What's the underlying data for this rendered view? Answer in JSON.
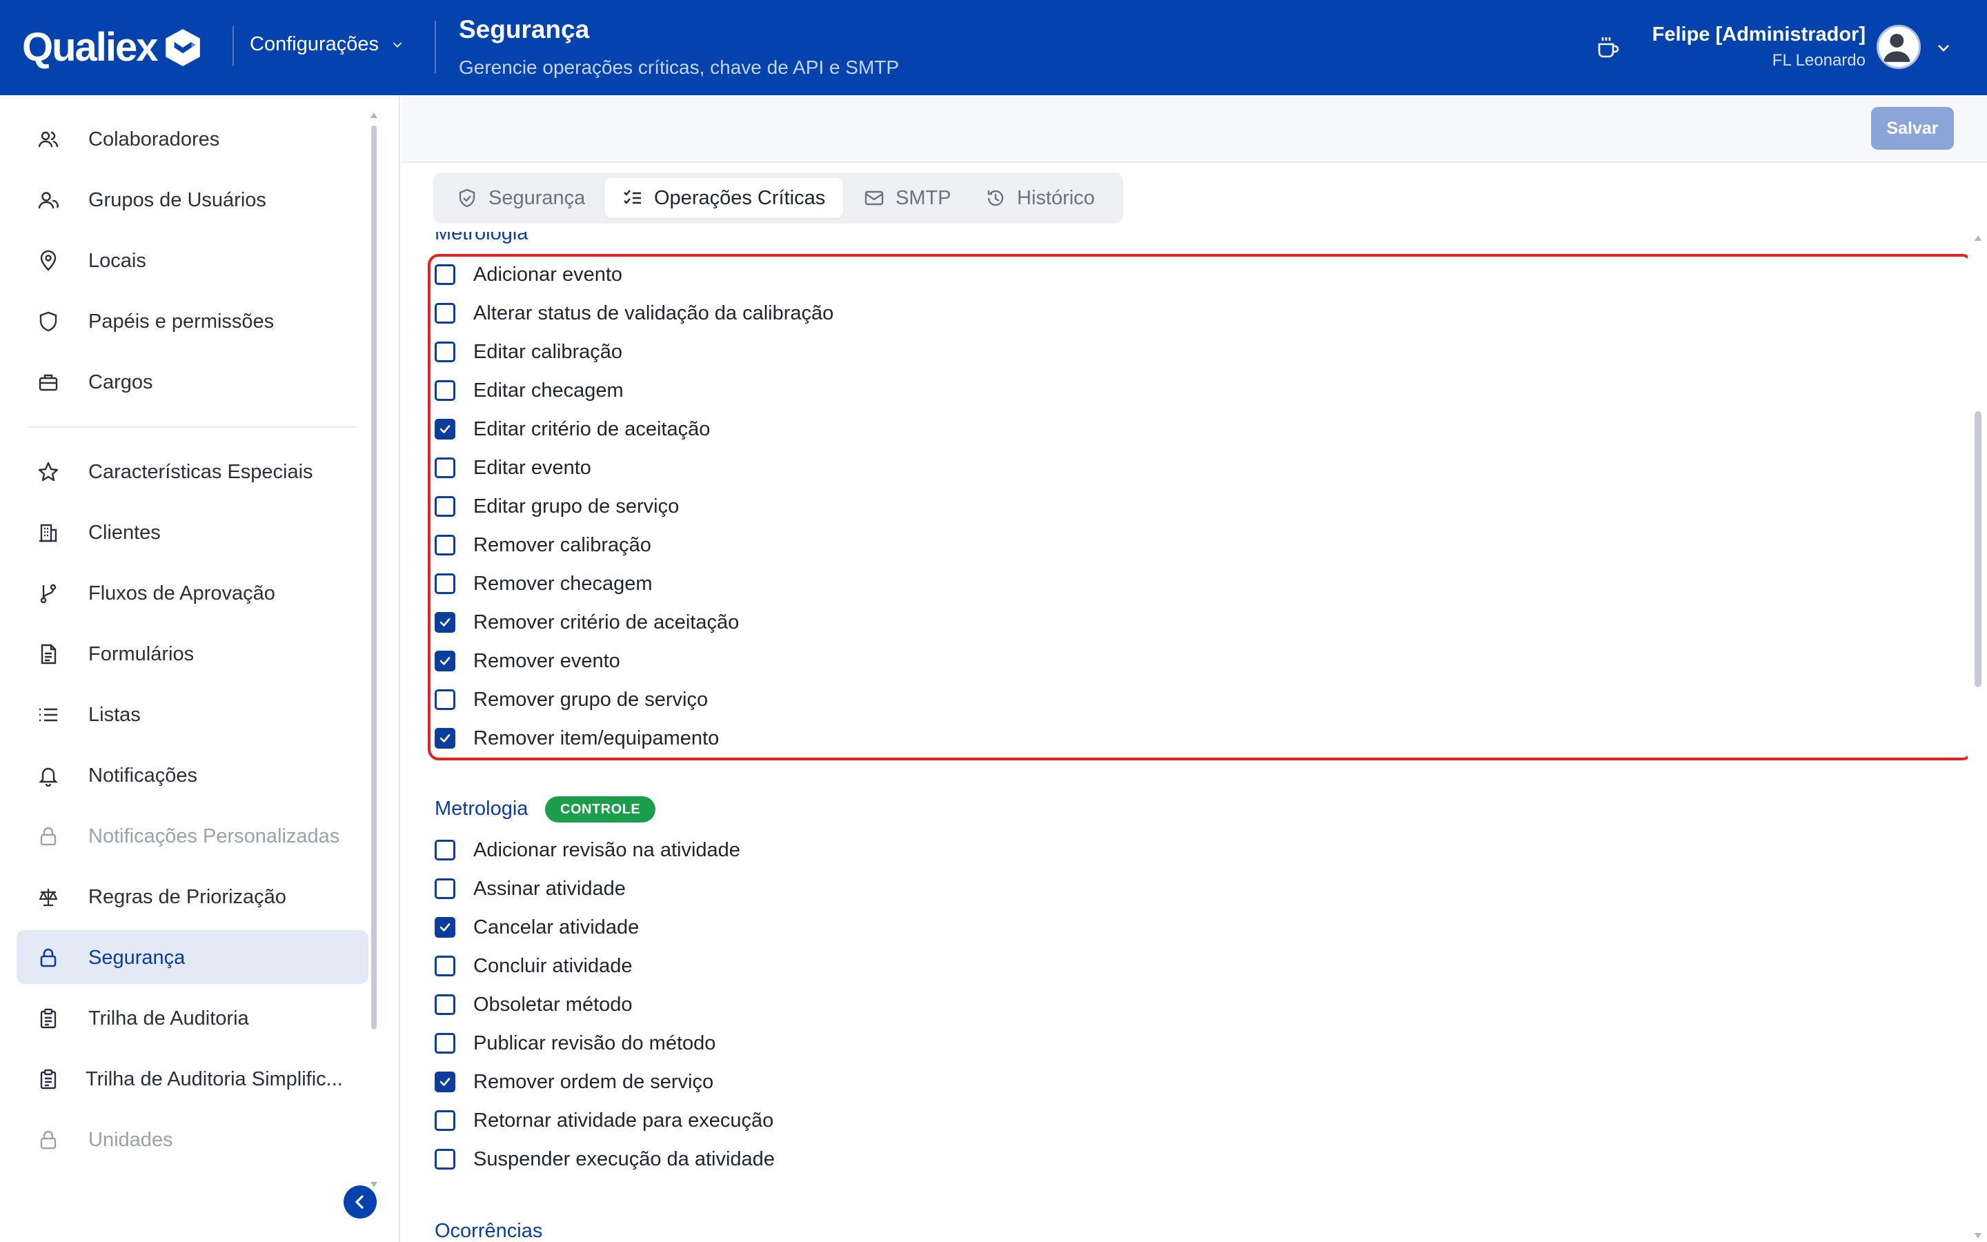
{
  "header": {
    "brand": "Qualiex",
    "module": "Configurações",
    "title": "Segurança",
    "subtitle": "Gerencie operações críticas, chave de API e SMTP",
    "user_name": "Felipe [Administrador]",
    "user_org": "FL Leonardo",
    "icons": [
      "coffee-icon",
      "avatar-icon",
      "chevron-down-icon"
    ]
  },
  "sidebar": {
    "items": [
      {
        "label": "Colaboradores",
        "icon": "users-icon",
        "state": "normal"
      },
      {
        "label": "Grupos de Usuários",
        "icon": "user-group-icon",
        "state": "normal"
      },
      {
        "label": "Locais",
        "icon": "map-pin-icon",
        "state": "normal"
      },
      {
        "label": "Papéis e permissões",
        "icon": "shield-icon",
        "state": "normal"
      },
      {
        "label": "Cargos",
        "icon": "briefcase-icon",
        "state": "normal"
      },
      {
        "label": "Características Especiais",
        "icon": "star-icon",
        "state": "normal"
      },
      {
        "label": "Clientes",
        "icon": "building-icon",
        "state": "normal"
      },
      {
        "label": "Fluxos de Aprovação",
        "icon": "git-branch-icon",
        "state": "normal"
      },
      {
        "label": "Formulários",
        "icon": "file-text-icon",
        "state": "normal"
      },
      {
        "label": "Listas",
        "icon": "list-icon",
        "state": "normal"
      },
      {
        "label": "Notificações",
        "icon": "bell-icon",
        "state": "normal"
      },
      {
        "label": "Notificações Personalizadas",
        "icon": "lock-icon",
        "state": "disabled"
      },
      {
        "label": "Regras de Priorização",
        "icon": "scale-icon",
        "state": "normal"
      },
      {
        "label": "Segurança",
        "icon": "lock-icon",
        "state": "active"
      },
      {
        "label": "Trilha de Auditoria",
        "icon": "clipboard-icon",
        "state": "normal"
      },
      {
        "label": "Trilha de Auditoria Simplific...",
        "icon": "clipboard-icon",
        "state": "normal"
      },
      {
        "label": "Unidades",
        "icon": "lock-icon",
        "state": "disabled"
      }
    ]
  },
  "toolbar": {
    "save_label": "Salvar"
  },
  "tabs": [
    {
      "label": "Segurança",
      "icon": "shield-check-icon",
      "active": false
    },
    {
      "label": "Operações Críticas",
      "icon": "list-checks-icon",
      "active": true
    },
    {
      "label": "SMTP",
      "icon": "mail-icon",
      "active": false
    },
    {
      "label": "Histórico",
      "icon": "history-icon",
      "active": false
    }
  ],
  "sections": [
    {
      "title": "Metrologia",
      "badge": "",
      "items": [
        {
          "label": "Adicionar evento",
          "checked": false
        },
        {
          "label": "Alterar status de validação da calibração",
          "checked": false
        },
        {
          "label": "Editar calibração",
          "checked": false
        },
        {
          "label": "Editar checagem",
          "checked": false
        },
        {
          "label": "Editar critério de aceitação",
          "checked": true
        },
        {
          "label": "Editar evento",
          "checked": false
        },
        {
          "label": "Editar grupo de serviço",
          "checked": false
        },
        {
          "label": "Remover calibração",
          "checked": false
        },
        {
          "label": "Remover checagem",
          "checked": false
        },
        {
          "label": "Remover critério de aceitação",
          "checked": true
        },
        {
          "label": "Remover evento",
          "checked": true
        },
        {
          "label": "Remover grupo de serviço",
          "checked": false
        },
        {
          "label": "Remover item/equipamento",
          "checked": true
        }
      ]
    },
    {
      "title": "Metrologia",
      "badge": "CONTROLE",
      "items": [
        {
          "label": "Adicionar revisão na atividade",
          "checked": false
        },
        {
          "label": "Assinar atividade",
          "checked": false
        },
        {
          "label": "Cancelar atividade",
          "checked": true
        },
        {
          "label": "Concluir atividade",
          "checked": false
        },
        {
          "label": "Obsoletar método",
          "checked": false
        },
        {
          "label": "Publicar revisão do método",
          "checked": false
        },
        {
          "label": "Remover ordem de serviço",
          "checked": true
        },
        {
          "label": "Retornar atividade para execução",
          "checked": false
        },
        {
          "label": "Suspender execução da atividade",
          "checked": false
        }
      ]
    },
    {
      "title": "Ocorrências",
      "badge": "",
      "items": []
    }
  ],
  "colors": {
    "header_bg": "#0442ad",
    "accent": "#0a3d9c",
    "badge_green": "#1b9e4b",
    "highlight_red": "#e02424",
    "save_disabled": "#8aa6d9"
  }
}
